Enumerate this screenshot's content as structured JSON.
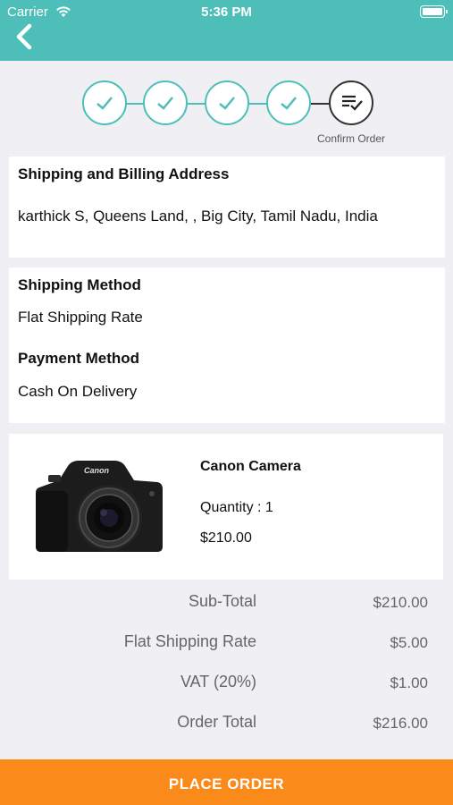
{
  "status_bar": {
    "carrier": "Carrier",
    "time": "5:36 PM"
  },
  "accent_color": "#4dbfb8",
  "button_color": "#fa8a1a",
  "stepper": {
    "steps_completed": 4,
    "current_label": "Confirm Order"
  },
  "address": {
    "title": "Shipping and Billing Address",
    "text": "karthick S, Queens Land, , Big City, Tamil Nadu, India"
  },
  "methods": {
    "shipping_title": "Shipping Method",
    "shipping_value": "Flat Shipping Rate",
    "payment_title": "Payment Method",
    "payment_value": "Cash On Delivery"
  },
  "product": {
    "name": "Canon Camera",
    "quantity": "Quantity : 1",
    "price": "$210.00"
  },
  "totals": [
    {
      "label": "Sub-Total",
      "value": "$210.00"
    },
    {
      "label": "Flat Shipping Rate",
      "value": "$5.00"
    },
    {
      "label": "VAT (20%)",
      "value": "$1.00"
    },
    {
      "label": "Order Total",
      "value": "$216.00"
    }
  ],
  "place_order_label": "PLACE ORDER"
}
